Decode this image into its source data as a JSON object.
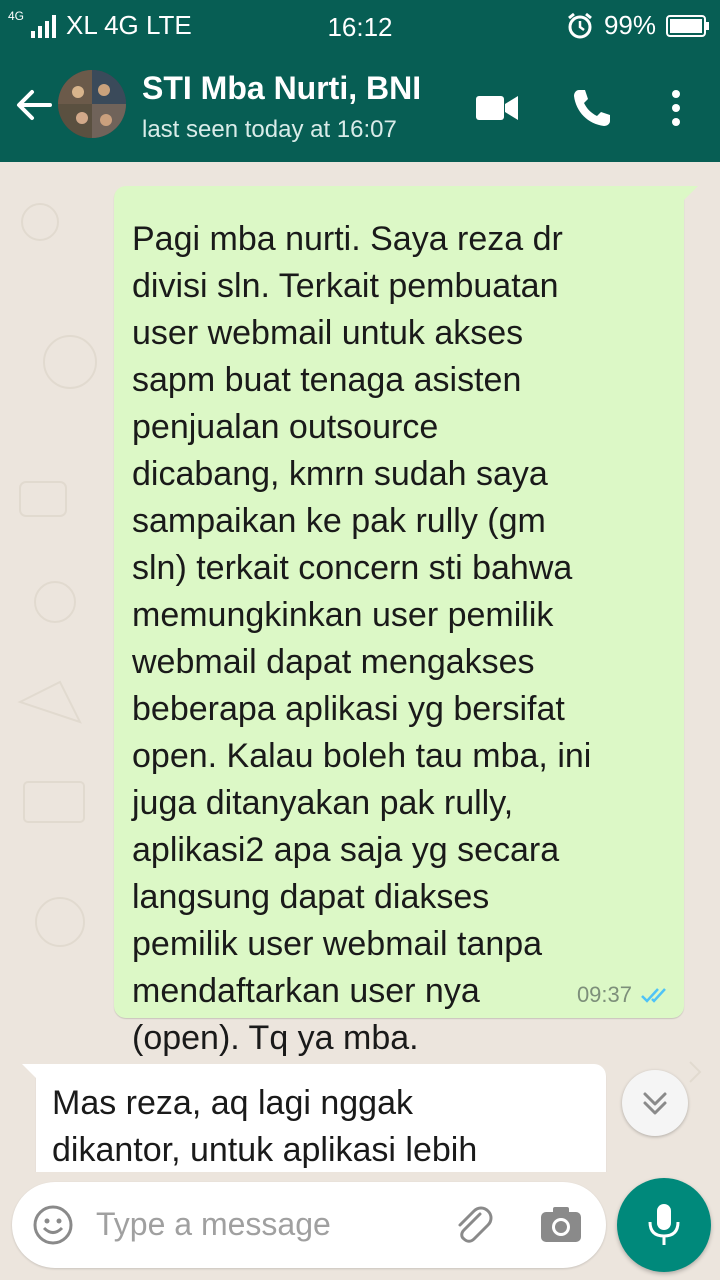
{
  "status_bar": {
    "network_small": "4G",
    "carrier": "XL 4G LTE",
    "time": "16:12",
    "battery": "99%"
  },
  "header": {
    "contact_name": "STI Mba Nurti, BNI",
    "last_seen": "last seen today at 16:07",
    "icons": [
      "back-arrow-icon",
      "video-call-icon",
      "phone-icon",
      "more-vert-icon"
    ]
  },
  "messages": [
    {
      "direction": "outgoing",
      "text": "Pagi mba nurti. Saya reza dr\ndivisi sln. Terkait pembuatan\nuser webmail untuk akses\nsapm buat tenaga asisten\npenjualan outsource\ndicabang, kmrn sudah saya\nsampaikan ke pak rully (gm\nsln) terkait concern sti bahwa\nmemungkinkan user pemilik\nwebmail dapat mengakses\nbeberapa aplikasi yg bersifat\nopen. Kalau boleh tau mba, ini\njuga ditanyakan pak rully,\naplikasi2 apa saja yg secara\nlangsung dapat diakses\npemilik user webmail tanpa\nmendaftarkan user nya\n(open). Tq ya mba.",
      "time": "09:37",
      "status": "read"
    },
    {
      "direction": "incoming",
      "text": "Mas reza, aq lagi nggak\ndikantor, untuk aplikasi lebih"
    }
  ],
  "composer": {
    "placeholder": "Type a message",
    "icons": [
      "emoji-icon",
      "attach-icon",
      "camera-icon",
      "mic-icon"
    ]
  },
  "colors": {
    "header": "#075e54",
    "outgoing_bubble": "#dcf8c6",
    "incoming_bubble": "#ffffff",
    "read_ticks": "#4fc3f7",
    "mic_button": "#00897b"
  }
}
